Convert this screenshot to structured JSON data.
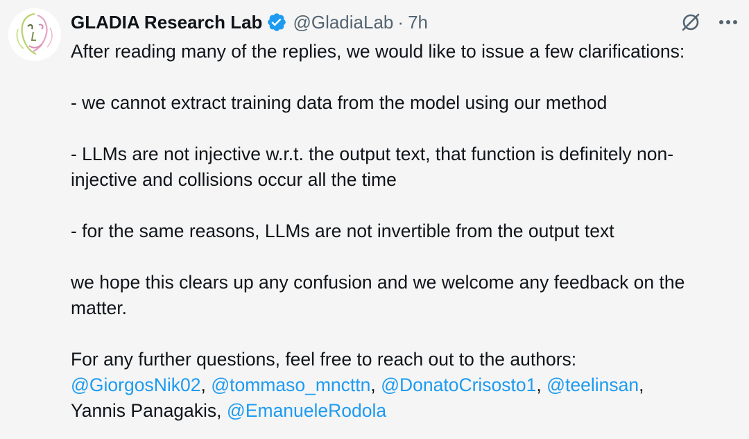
{
  "author": {
    "display_name": "GLADIA Research Lab",
    "handle": "@GladiaLab",
    "separator": "·",
    "time": "7h",
    "verified_icon": "verified-badge-icon",
    "avatar_icon": "face-line-art-icon"
  },
  "actions": {
    "grok_icon": "grok-icon",
    "more_icon": "more-options-icon"
  },
  "colors": {
    "background": "#f5f5f5",
    "text": "#0f1419",
    "secondary": "#536471",
    "link": "#1d9bf0",
    "verified": "#1d9bf0"
  },
  "tweet": {
    "intro": "After reading many of the replies, we would like to issue a few clarifications:",
    "point1": "- we cannot extract training data from the model using our method",
    "point2_line1": "- LLMs are not injective w.r.t. the output text, that function is definitely non-",
    "point2_line2": "injective and collisions occur all the time",
    "point3": "- for the same reasons, LLMs are not invertible from the output text",
    "closing_line1": "we hope this clears up any confusion and we welcome any feedback on the",
    "closing_line2": "matter.",
    "contact_line": "For any further questions, feel free to reach out to the authors:",
    "mentions": {
      "m1": "@GiorgosNik02",
      "m2": "@tommaso_mncttn",
      "m3": "@DonatoCrisosto1",
      "m4": "@teelinsan",
      "m5": "@EmanueleRodola"
    },
    "comma": ",",
    "plain_author": "Yannis Panagakis,"
  }
}
